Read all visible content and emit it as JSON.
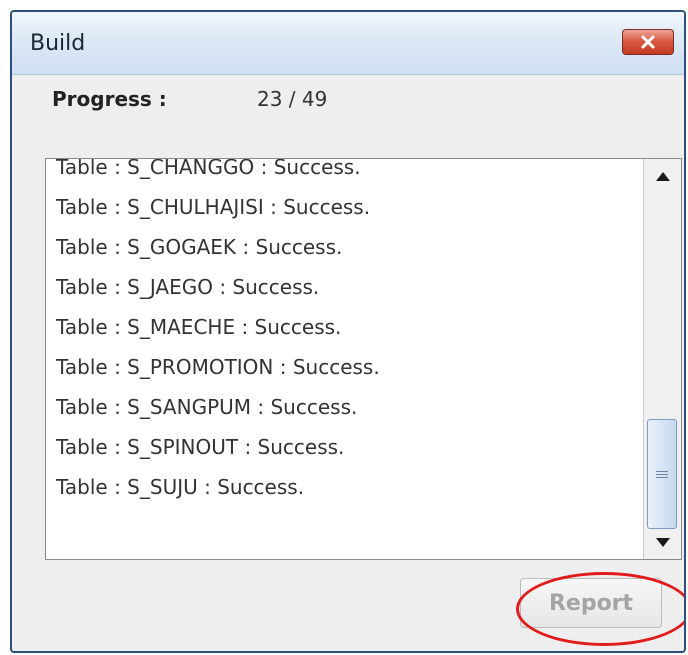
{
  "window": {
    "title": "Build",
    "close_icon": "close-icon"
  },
  "progress": {
    "label": "Progress :",
    "value": "23 / 49"
  },
  "log": {
    "items": [
      "Table : S_CHANGGO : Success.",
      "Table : S_CHULHAJISI : Success.",
      "Table : S_GOGAEK : Success.",
      "Table : S_JAEGO : Success.",
      "Table : S_MAECHE : Success.",
      "Table : S_PROMOTION : Success.",
      "Table : S_SANGPUM : Success.",
      "Table : S_SPINOUT : Success.",
      "Table : S_SUJU : Success."
    ],
    "scrollbar_icons": [
      "arrow-up-icon",
      "arrow-down-icon",
      "scroll-grip-icon"
    ]
  },
  "footer": {
    "report_label": "Report",
    "report_enabled": false,
    "highlight_color": "#e11b1b"
  }
}
